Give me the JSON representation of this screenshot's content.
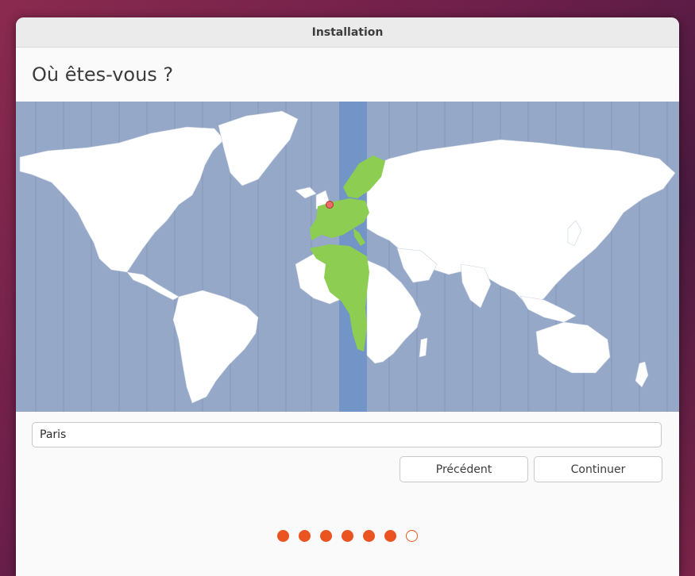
{
  "window": {
    "title": "Installation"
  },
  "page": {
    "heading": "Où êtes-vous ?"
  },
  "location": {
    "selected_city": "Paris",
    "timezone_offset_hours": 1
  },
  "buttons": {
    "back_label": "Précédent",
    "continue_label": "Continuer"
  },
  "progress": {
    "total_steps": 7,
    "completed_steps": 6
  },
  "colors": {
    "accent": "#e95420",
    "ocean": "#95a8c7",
    "timezone_band": "#7394c6",
    "land": "#ffffff",
    "timezone_land": "#8ccd52",
    "marker": "#ef6a6a"
  },
  "icons": {
    "map_marker": "map-pin-icon"
  }
}
